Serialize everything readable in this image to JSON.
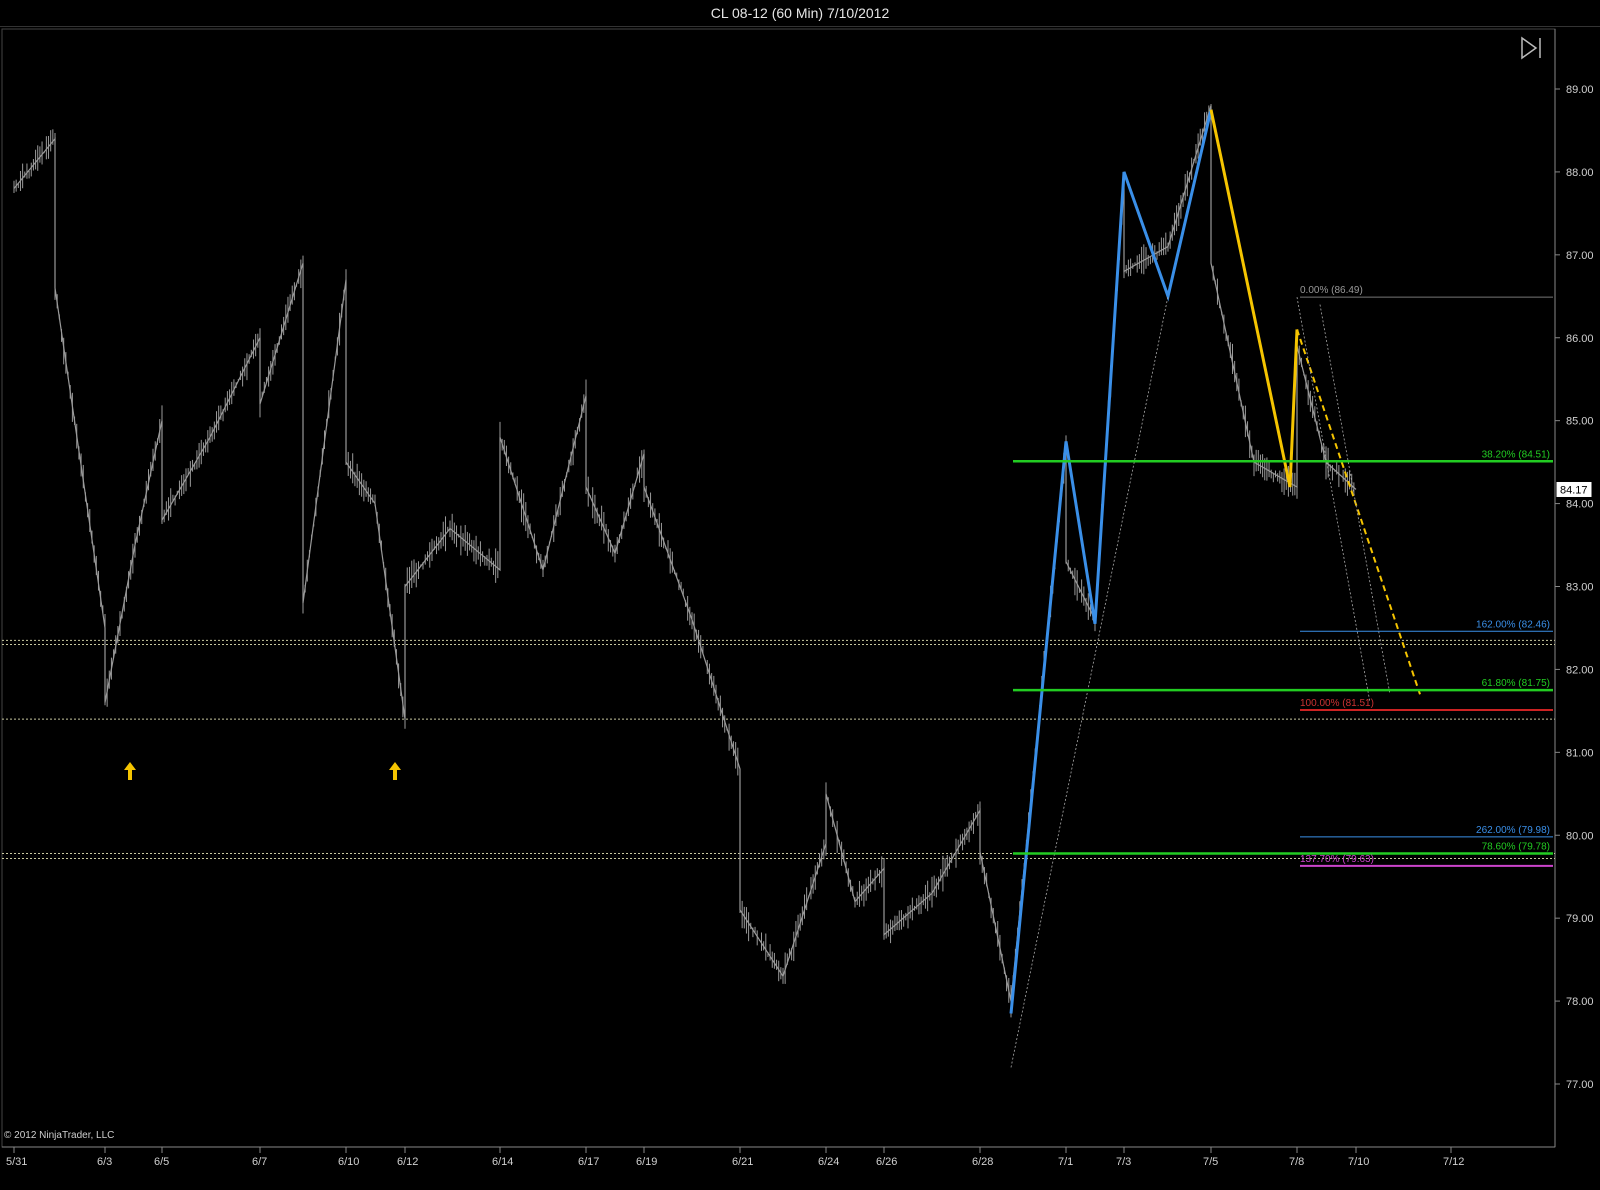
{
  "window": {
    "title": "CL 08-12 (60 Min)  7/10/2012"
  },
  "copyright": "© 2012 NinjaTrader, LLC",
  "icons": {
    "skip_to_end": "skip-to-end-icon",
    "arrow": "up-arrow-icon"
  },
  "colors": {
    "background": "#000000",
    "price": "#9a9a9a",
    "blue_wave": "#3a8fe8",
    "yellow_wave": "#f5c400",
    "green_line": "#22cc22",
    "red_line": "#cc2222",
    "blue_line": "#3a8fe8",
    "magenta_line": "#cc44cc",
    "dotted_line": "#c8c8a0"
  },
  "chart_data": {
    "type": "line",
    "title": "CL 08-12 (60 Min)  7/10/2012",
    "x_ticks": [
      "5/31",
      "6/3",
      "6/5",
      "6/7",
      "6/10",
      "6/12",
      "6/14",
      "6/17",
      "6/19",
      "6/21",
      "6/24",
      "6/26",
      "6/28",
      "7/1",
      "7/3",
      "7/5",
      "7/8",
      "7/10",
      "7/12"
    ],
    "y_ticks": [
      "77.00",
      "78.00",
      "79.00",
      "80.00",
      "81.00",
      "82.00",
      "83.00",
      "84.00",
      "85.00",
      "86.00",
      "87.00",
      "88.00",
      "89.00"
    ],
    "ylim": [
      76.6,
      89.5
    ],
    "last_price": "84.17",
    "series": [
      {
        "x": [
          "5/31",
          "6/1",
          "6/1",
          "6/3",
          "6/3",
          "6/4",
          "6/5",
          "6/5",
          "6/6",
          "6/7",
          "6/7",
          "6/8",
          "6/8",
          "6/10",
          "6/10",
          "6/11",
          "6/12",
          "6/12",
          "6/13",
          "6/14",
          "6/14",
          "6/15",
          "6/17",
          "6/17",
          "6/18",
          "6/19",
          "6/19",
          "6/20",
          "6/21",
          "6/21",
          "6/22",
          "6/24",
          "6/24",
          "6/25",
          "6/26",
          "6/26",
          "6/27",
          "6/28",
          "6/28",
          "6/29",
          "7/1",
          "7/1",
          "7/2",
          "7/3",
          "7/3",
          "7/4",
          "7/5",
          "7/5",
          "7/6",
          "7/8",
          "7/8",
          "7/9",
          "7/10"
        ],
        "y": [
          87.8,
          88.4,
          86.6,
          82.5,
          81.6,
          83.5,
          85.0,
          83.8,
          84.8,
          86.0,
          85.2,
          86.9,
          82.8,
          86.7,
          84.5,
          84.0,
          81.4,
          83.0,
          83.7,
          83.2,
          84.8,
          83.2,
          85.3,
          84.2,
          83.4,
          84.6,
          84.2,
          82.6,
          80.8,
          79.1,
          78.3,
          79.9,
          80.5,
          79.2,
          79.6,
          78.8,
          79.3,
          80.3,
          79.8,
          78.0,
          84.7,
          83.3,
          82.6,
          87.9,
          86.8,
          87.1,
          88.8,
          86.9,
          84.5,
          84.2,
          85.9,
          84.5,
          84.17
        ]
      }
    ],
    "annotations": {
      "blue_wave": [
        [
          "6/29",
          77.85
        ],
        [
          "7/1",
          84.75
        ],
        [
          "7/2",
          82.55
        ],
        [
          "7/3",
          88.0
        ],
        [
          "7/4",
          86.5
        ],
        [
          "7/5",
          88.75
        ]
      ],
      "yellow_wave": [
        [
          "7/5",
          88.75
        ],
        [
          "7/7",
          84.2
        ],
        [
          "7/8",
          86.1
        ],
        [
          "7/11",
          81.7
        ]
      ],
      "fib_right": [
        {
          "label": "38.20% (84.51)",
          "value": 84.51
        },
        {
          "label": "61.80% (81.75)",
          "value": 81.75
        },
        {
          "label": "78.60% (79.78)",
          "value": 79.78
        }
      ],
      "fib_ext": [
        {
          "label": "0.00% (86.49)",
          "value": 86.49
        },
        {
          "label": "162.00% (82.46)",
          "value": 82.46
        },
        {
          "label": "100.00% (81.51)",
          "value": 81.51
        },
        {
          "label": "262.00% (79.98)",
          "value": 79.98
        },
        {
          "label": "137.70% (79.63)",
          "value": 79.63
        }
      ],
      "support_levels": [
        82.35,
        82.3,
        81.4,
        79.78,
        79.72
      ],
      "arrows": [
        "6/3",
        "6/12"
      ]
    }
  }
}
